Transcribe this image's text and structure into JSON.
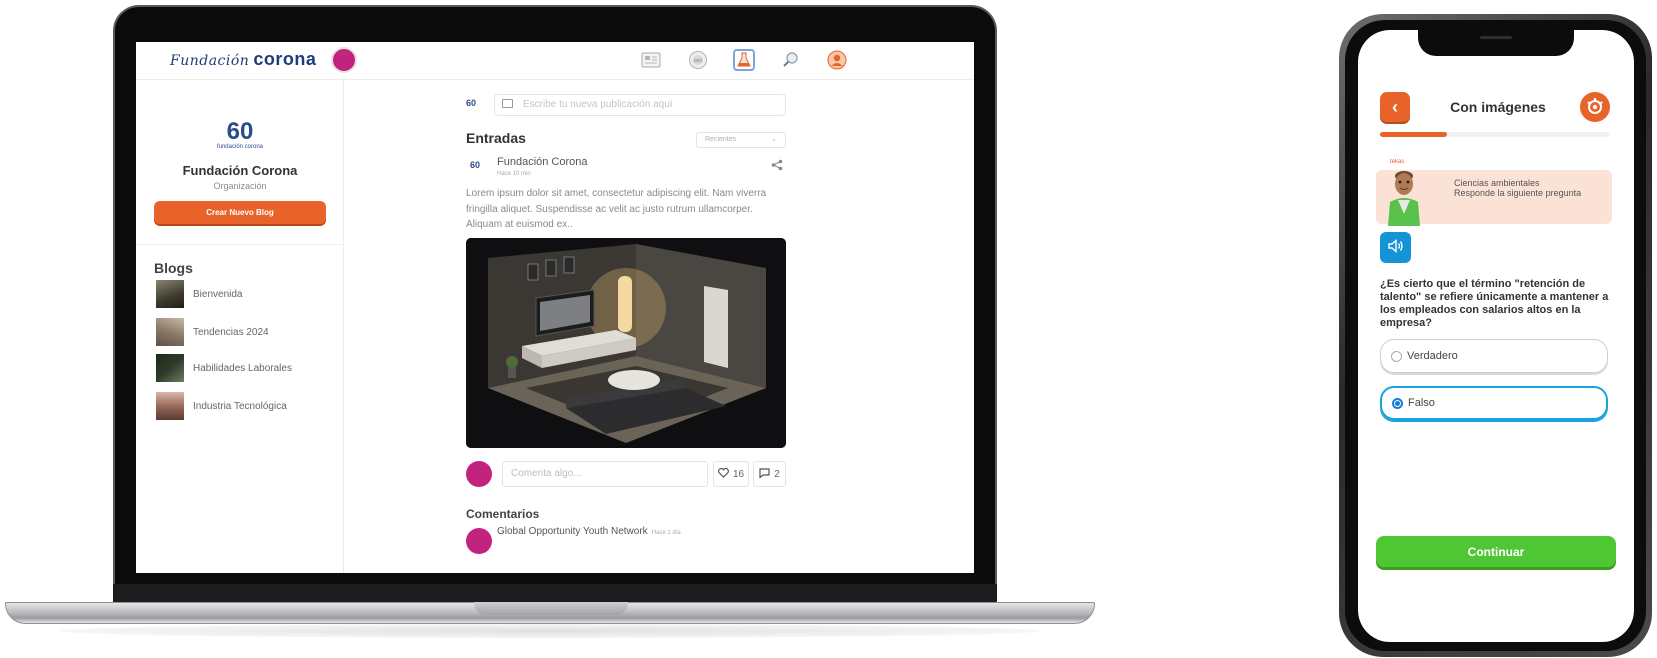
{
  "laptop": {
    "header": {
      "brand_script": "Fundación",
      "brand_bold": "corona",
      "nav_icons": [
        "feed-icon",
        "chat-icon",
        "lab-flask-icon",
        "search-icon",
        "profile-icon"
      ]
    },
    "sidebar": {
      "org_logo_number": "60",
      "org_logo_caption": "fundación corona",
      "org_name": "Fundación Corona",
      "org_type": "Organización",
      "create_button": "Crear Nuevo Blog",
      "blogs_title": "Blogs",
      "blogs": [
        {
          "label": "Bienvenida",
          "thumb_color": "#3d3a2e"
        },
        {
          "label": "Tendencias 2024",
          "thumb_color": "#8a7a6a"
        },
        {
          "label": "Habilidades Laborales",
          "thumb_color": "#2e3a2a"
        },
        {
          "label": "Industria Tecnológica",
          "thumb_color": "#9a6a5a"
        }
      ]
    },
    "feed": {
      "composer_logo": "60",
      "composer_placeholder": "Escribe tu nueva publicación aquí",
      "entries_title": "Entradas",
      "sort_value": "Recientes",
      "post": {
        "logo": "60",
        "author": "Fundación Corona",
        "time": "Hace 10 min",
        "body": "Lorem ipsum dolor sit amet, consectetur adipiscing elit. Nam viverra fringilla aliquet. Suspendisse ac velit ac justo rutrum ullamcorper. Aliquam at euismod ex..",
        "comment_placeholder": "Comenta algo...",
        "likes": "16",
        "comments": "2"
      },
      "comments_title": "Comentarios",
      "first_comment": {
        "author": "Global Opportunity Youth Network",
        "time": "Hace 1 día"
      }
    }
  },
  "phone": {
    "title": "Con imágenes",
    "progress": 0.29,
    "mascot_tag": "tekas",
    "subject": "Ciencias ambientales",
    "instruction": "Responde la siguiente pregunta",
    "question": "¿Es cierto que el término \"retención de talento\" se refiere únicamente a mantener a los empleados con salarios altos en la empresa?",
    "options": [
      {
        "label": "Verdadero",
        "selected": false
      },
      {
        "label": "Falso",
        "selected": true
      }
    ],
    "continue_button": "Continuar"
  },
  "colors": {
    "accent_orange": "#e8632a",
    "brand_blue": "#1f3c7a",
    "avatar_magenta": "#c2237f",
    "audio_blue": "#1493d9",
    "continue_green": "#4fc735"
  }
}
